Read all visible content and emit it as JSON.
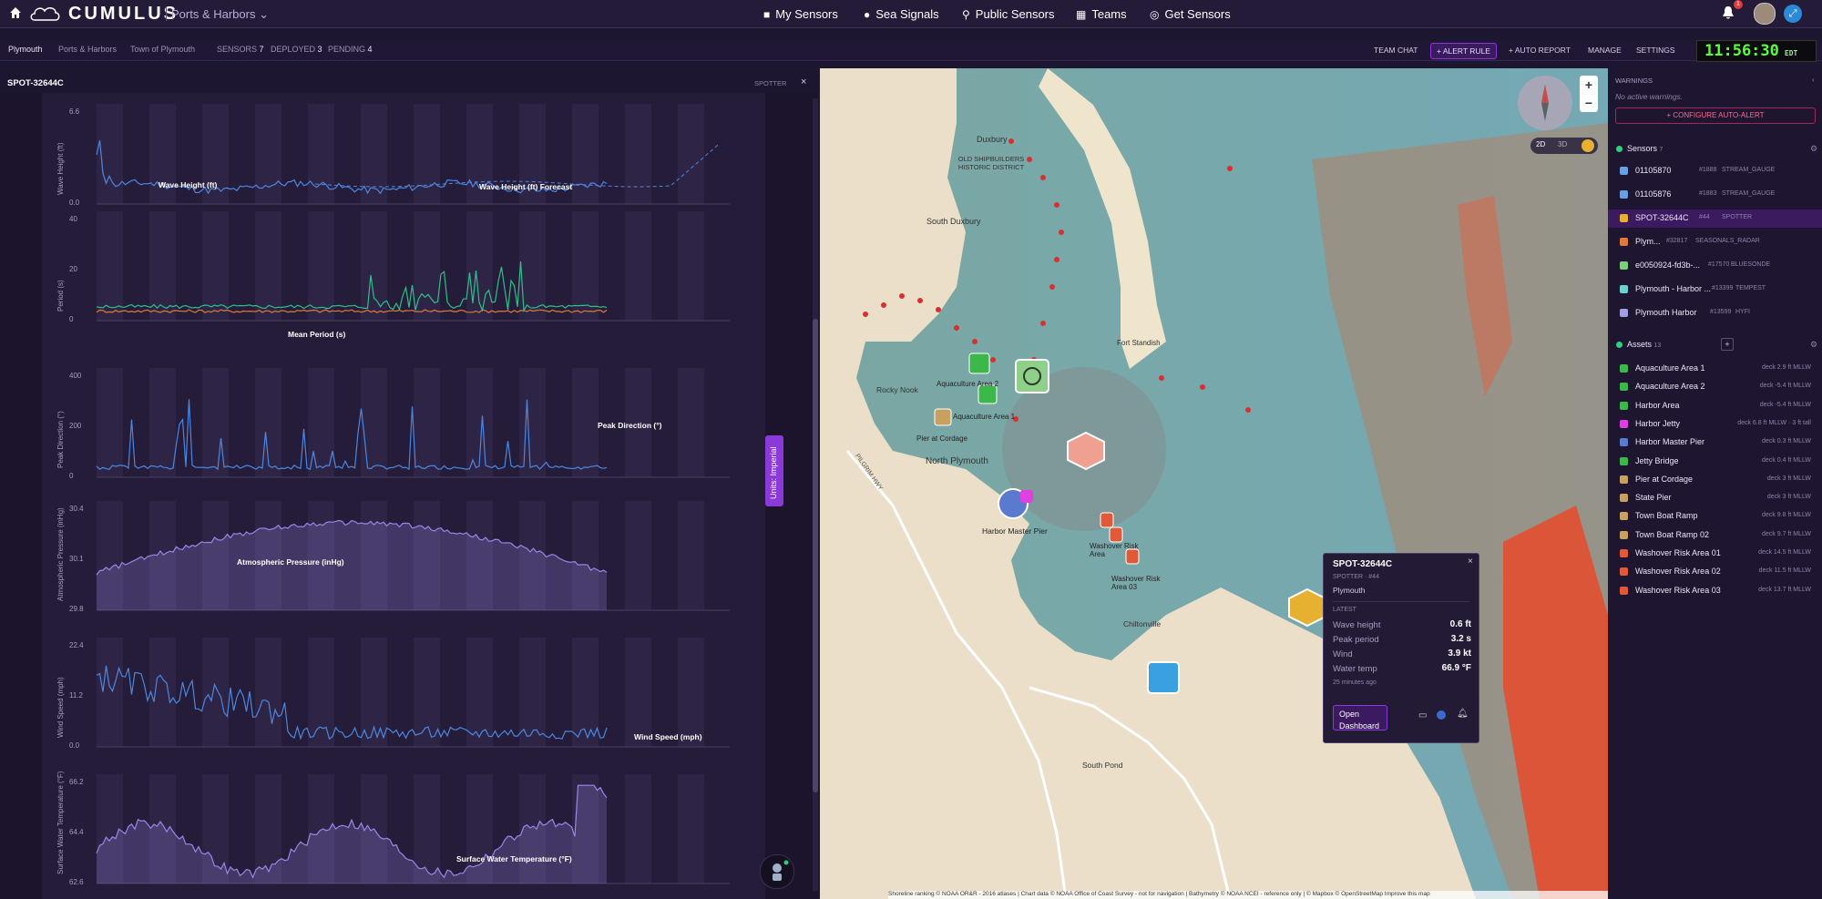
{
  "app": {
    "brand": "CUMULUS",
    "org": "Ports & Harbors"
  },
  "nav": {
    "home_icon": "home-icon",
    "items": [
      {
        "label": "My Sensors",
        "icon": "square-icon"
      },
      {
        "label": "Sea Signals",
        "icon": "circle-icon"
      },
      {
        "label": "Public Sensors",
        "icon": "pin-icon"
      },
      {
        "label": "Teams",
        "icon": "grid-icon"
      },
      {
        "label": "Get Sensors",
        "icon": "target-icon"
      }
    ],
    "notif_count": "1"
  },
  "subbar": {
    "location": "Plymouth",
    "org": "Ports & Harbors",
    "town": "Town of Plymouth",
    "sensors_label": "SENSORS",
    "sensors": "7",
    "deployed_label": "DEPLOYED",
    "deployed": "3",
    "pending_label": "PENDING",
    "pending": "4",
    "buttons": [
      "TEAM CHAT",
      "+ ALERT RULE",
      "+ AUTO REPORT",
      "MANAGE",
      "SETTINGS"
    ],
    "clock": "11:56:30",
    "tz": "EDT"
  },
  "panel": {
    "sensor_id": "SPOT-32644C",
    "type": "SPOTTER",
    "units": "Units: Imperial"
  },
  "chart_data": [
    {
      "type": "line",
      "ylabel": "Wave Height (ft)",
      "ylim": [
        0,
        9
      ],
      "yticks": [
        "0.0",
        "6.6"
      ],
      "series": [
        {
          "name": "Wave Height (ft)",
          "color": "#4d86e0"
        },
        {
          "name": "Wave Height (ft) Forecast",
          "color": "#4d86e0"
        }
      ]
    },
    {
      "type": "line",
      "ylabel": "Period (s)",
      "ylim": [
        0,
        40
      ],
      "yticks": [
        "0",
        "20",
        "40"
      ],
      "series": [
        {
          "name": "Mean Period (s)",
          "color": "#e07a3a"
        },
        {
          "color": "#2fbf8a"
        }
      ]
    },
    {
      "type": "line",
      "ylabel": "Peak Direction (°)",
      "ylim": [
        0,
        400
      ],
      "yticks": [
        "0",
        "200",
        "400"
      ],
      "series": [
        {
          "name": "Peak Direction (°)",
          "color": "#4d86e0"
        }
      ]
    },
    {
      "type": "area",
      "ylabel": "Atmospheric Pressure (inHg)",
      "ylim": [
        29.8,
        30.4
      ],
      "yticks": [
        "29.8",
        "30.1",
        "30.4"
      ],
      "series": [
        {
          "name": "Atmospheric Pressure (inHg)",
          "color": "#9a86e8"
        }
      ]
    },
    {
      "type": "line",
      "ylabel": "Wind Speed (mph)",
      "ylim": [
        0,
        25
      ],
      "yticks": [
        "0.0",
        "11.2",
        "22.4"
      ],
      "series": [
        {
          "name": "Wind Speed (mph)",
          "color": "#4d86e0"
        }
      ]
    },
    {
      "type": "area",
      "ylabel": "Surface Water Temperature (°F)",
      "ylim": [
        62.6,
        66.8
      ],
      "yticks": [
        "62.6",
        "64.4",
        "66.2"
      ],
      "series": [
        {
          "name": "Surface Water Temperature (°F)",
          "color": "#9a86e8"
        }
      ]
    }
  ],
  "map": {
    "buttons": {
      "zoom_in": "+",
      "zoom_out": "−",
      "mode2d": "2D",
      "mode3d": "3D"
    },
    "labels": [
      "Duxbury",
      "OLD SHIPBUILDERS HISTORIC DISTRICT",
      "South Duxbury",
      "Rocky Nook",
      "Aquaculture Area 2",
      "Aquaculture Area 1",
      "Pier at Cordage",
      "North Plymouth",
      "Fort Standish",
      "Harbor Master Pier",
      "Washover Risk Area",
      "Washover Risk Area 03",
      "Chiltonville",
      "South Pond",
      "PILGRIM HWY"
    ],
    "attribution": "Shoreline ranking © NOAA OR&R - 2016 atlases | Chart data © NOAA Office of Coast Survey - not for navigation | Bathymetry © NOAA NCEI - reference only | © Mapbox © OpenStreetMap  Improve this map"
  },
  "popup": {
    "title": "SPOT-32644C",
    "subtitle": "SPOTTER · #44",
    "place": "Plymouth",
    "section": "LATEST",
    "rows": [
      {
        "label": "Wave height",
        "value": "0.6 ft"
      },
      {
        "label": "Peak period",
        "value": "3.2 s"
      },
      {
        "label": "Wind",
        "value": "3.9 kt"
      },
      {
        "label": "Water temp",
        "value": "66.9 °F"
      }
    ],
    "ago": "25 minutes ago",
    "open_btn": "Open Dashboard"
  },
  "warnings": {
    "title": "WARNINGS",
    "empty": "No active warnings.",
    "configure": "+ CONFIGURE AUTO-ALERT"
  },
  "sensors": {
    "title": "Sensors",
    "count": "7",
    "items": [
      {
        "name": "01105870",
        "id": "#1888",
        "type": "STREAM_GAUGE",
        "color": "#6a9fe0"
      },
      {
        "name": "01105876",
        "id": "#1883",
        "type": "STREAM_GAUGE",
        "color": "#6a9fe0"
      },
      {
        "name": "SPOT-32644C",
        "id": "#44",
        "type": "SPOTTER",
        "color": "#e6b030"
      },
      {
        "name": "Plym...",
        "id": "#32817",
        "type": "SEASONALS_RADAR",
        "color": "#e07a3a"
      },
      {
        "name": "e0050924-fd3b-...",
        "id": "#17570",
        "type": "BLUESONDE",
        "color": "#7ad07a"
      },
      {
        "name": "Plymouth - Harbor ...",
        "id": "#13399",
        "type": "TEMPEST",
        "color": "#6ad0d0"
      },
      {
        "name": "Plymouth Harbor",
        "id": "#13599",
        "type": "HYFI",
        "color": "#a0a0e0"
      }
    ]
  },
  "assets": {
    "title": "Assets",
    "count": "13",
    "items": [
      {
        "name": "Aquaculture Area 1",
        "depth": "deck 2.9 ft MLLW",
        "color": "#3cb84a"
      },
      {
        "name": "Aquaculture Area 2",
        "depth": "deck -5.4 ft MLLW",
        "color": "#3cb84a"
      },
      {
        "name": "Harbor Area",
        "depth": "deck -5.4 ft MLLW",
        "color": "#3cb84a"
      },
      {
        "name": "Harbor Jetty",
        "depth": "deck 6.8 ft MLLW · 3 ft tall",
        "color": "#e040e0"
      },
      {
        "name": "Harbor Master Pier",
        "depth": "deck 0.3 ft MLLW",
        "color": "#5a7ad0"
      },
      {
        "name": "Jetty Bridge",
        "depth": "deck 0.4 ft MLLW",
        "color": "#3cb84a"
      },
      {
        "name": "Pier at Cordage",
        "depth": "deck 3 ft MLLW",
        "color": "#c8a060"
      },
      {
        "name": "State Pier",
        "depth": "deck 3 ft MLLW",
        "color": "#c8a060"
      },
      {
        "name": "Town Boat Ramp",
        "depth": "deck 9.8 ft MLLW",
        "color": "#c8a060"
      },
      {
        "name": "Town Boat Ramp 02",
        "depth": "deck 9.7 ft MLLW",
        "color": "#c8a060"
      },
      {
        "name": "Washover Risk Area 01",
        "depth": "deck 14.5 ft MLLW",
        "color": "#e05a3a"
      },
      {
        "name": "Washover Risk Area 02",
        "depth": "deck 11.5 ft MLLW",
        "color": "#e05a3a"
      },
      {
        "name": "Washover Risk Area 03",
        "depth": "deck 13.7 ft MLLW",
        "color": "#e05a3a"
      }
    ]
  }
}
